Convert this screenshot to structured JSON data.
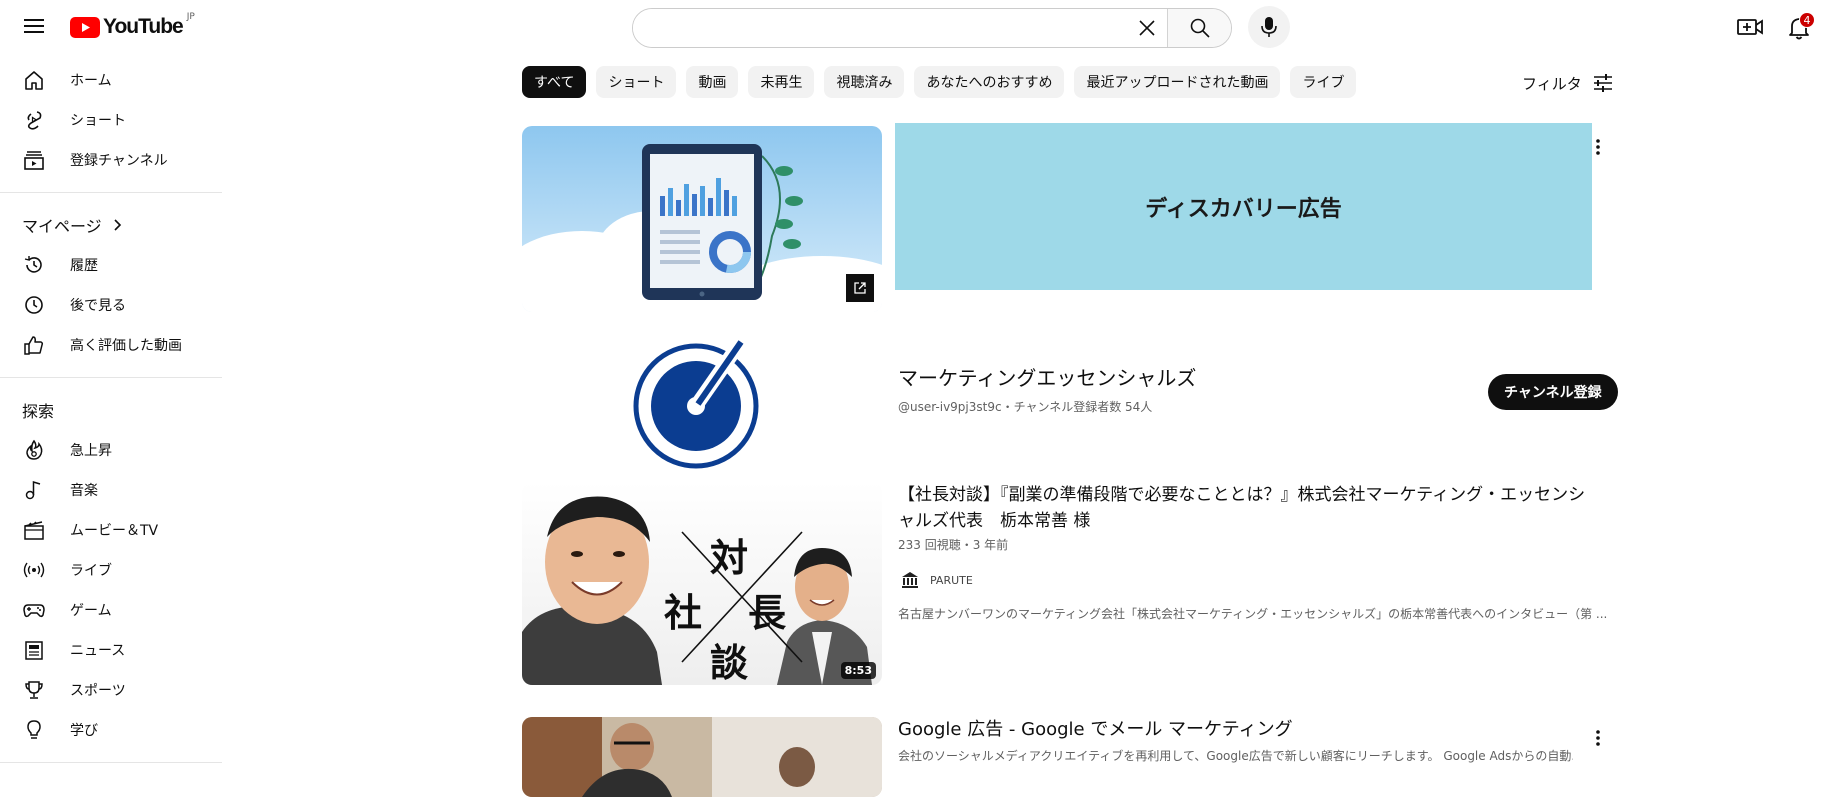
{
  "header": {
    "logo_text": "YouTube",
    "region": "JP",
    "search": {
      "value": "",
      "placeholder": ""
    },
    "notification_count": "4"
  },
  "sidebar": {
    "main": [
      {
        "label": "ホーム",
        "icon": "home-icon"
      },
      {
        "label": "ショート",
        "icon": "shorts-icon"
      },
      {
        "label": "登録チャンネル",
        "icon": "subscriptions-icon"
      }
    ],
    "mypage": {
      "title": "マイページ",
      "items": [
        {
          "label": "履歴",
          "icon": "history-icon"
        },
        {
          "label": "後で見る",
          "icon": "watch-later-icon"
        },
        {
          "label": "高く評価した動画",
          "icon": "thumbs-up-icon"
        }
      ]
    },
    "explore": {
      "title": "探索",
      "items": [
        {
          "label": "急上昇",
          "icon": "trending-icon"
        },
        {
          "label": "音楽",
          "icon": "music-icon"
        },
        {
          "label": "ムービー＆TV",
          "icon": "movie-icon"
        },
        {
          "label": "ライブ",
          "icon": "live-icon"
        },
        {
          "label": "ゲーム",
          "icon": "gaming-icon"
        },
        {
          "label": "ニュース",
          "icon": "news-icon"
        },
        {
          "label": "スポーツ",
          "icon": "trophy-icon"
        },
        {
          "label": "学び",
          "icon": "lightbulb-icon"
        }
      ]
    }
  },
  "chips": [
    "すべて",
    "ショート",
    "動画",
    "未再生",
    "視聴済み",
    "あなたへのおすすめ",
    "最近アップロードされた動画",
    "ライブ"
  ],
  "filter_label": "フィルタ",
  "ad": {
    "banner_text": "ディスカバリー広告"
  },
  "channel": {
    "name": "マーケティングエッセンシャルズ",
    "meta": "@user-iv9pj3st9c・チャンネル登録者数 54人",
    "subscribe_label": "チャンネル登録"
  },
  "video1": {
    "title": "【社長対談】『副業の準備段階で必要なこととは？』株式会社マーケティング・エッセンシャルズ代表　栃本常善 様",
    "meta": "233 回視聴・3 年前",
    "channel": "PARUTE",
    "description": "名古屋ナンバーワンのマーケティング会社「株式会社マーケティング・エッセンシャルズ」の栃本常善代表へのインタビュー（第 ...",
    "duration": "8:53",
    "thumb_chars": {
      "top": "対",
      "left": "社",
      "right": "長",
      "bottom": "談"
    }
  },
  "video2": {
    "title": "Google 広告 - Google でメール マーケティング",
    "description": "会社のソーシャルメディアクリエイティブを再利用して、Google広告で新しい顧客にリーチします。 Google Adsからの自動..."
  },
  "colors": {
    "brand_red": "#ff0000",
    "ad_banner": "#9ed9e8",
    "channel_logo": "#0b3d91"
  }
}
